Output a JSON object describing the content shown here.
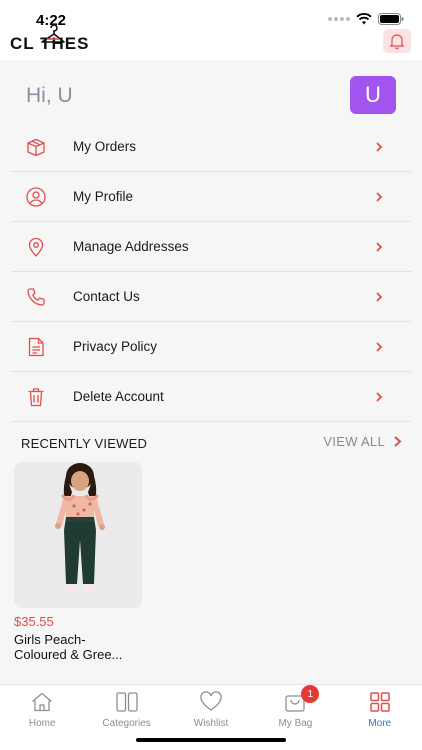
{
  "status_bar": {
    "time": "4:22"
  },
  "header": {
    "logo_text": "CL THES",
    "bell_icon": "bell-icon",
    "accent": "#e14e4e"
  },
  "profile": {
    "greeting": "Hi, U",
    "avatar_initial": "U",
    "avatar_color": "#a155ee"
  },
  "menu": [
    {
      "label": "My Orders",
      "icon": "box-icon"
    },
    {
      "label": "My Profile",
      "icon": "user-icon"
    },
    {
      "label": "Manage Addresses",
      "icon": "location-icon"
    },
    {
      "label": "Contact Us",
      "icon": "phone-icon"
    },
    {
      "label": "Privacy Policy",
      "icon": "document-icon"
    },
    {
      "label": "Delete Account",
      "icon": "trash-icon"
    }
  ],
  "recently_viewed": {
    "title": "RECENTLY VIEWED",
    "view_all": "VIEW ALL",
    "products": [
      {
        "price": "$35.55",
        "name_line1": "Girls Peach-",
        "name_line2": "Coloured & Gree..."
      }
    ]
  },
  "bottom_nav": [
    {
      "label": "Home",
      "icon": "home-icon"
    },
    {
      "label": "Categories",
      "icon": "categories-icon"
    },
    {
      "label": "Wishlist",
      "icon": "heart-icon"
    },
    {
      "label": "My Bag",
      "icon": "bag-icon",
      "badge": "1"
    },
    {
      "label": "More",
      "icon": "grid-icon",
      "active": true
    }
  ]
}
